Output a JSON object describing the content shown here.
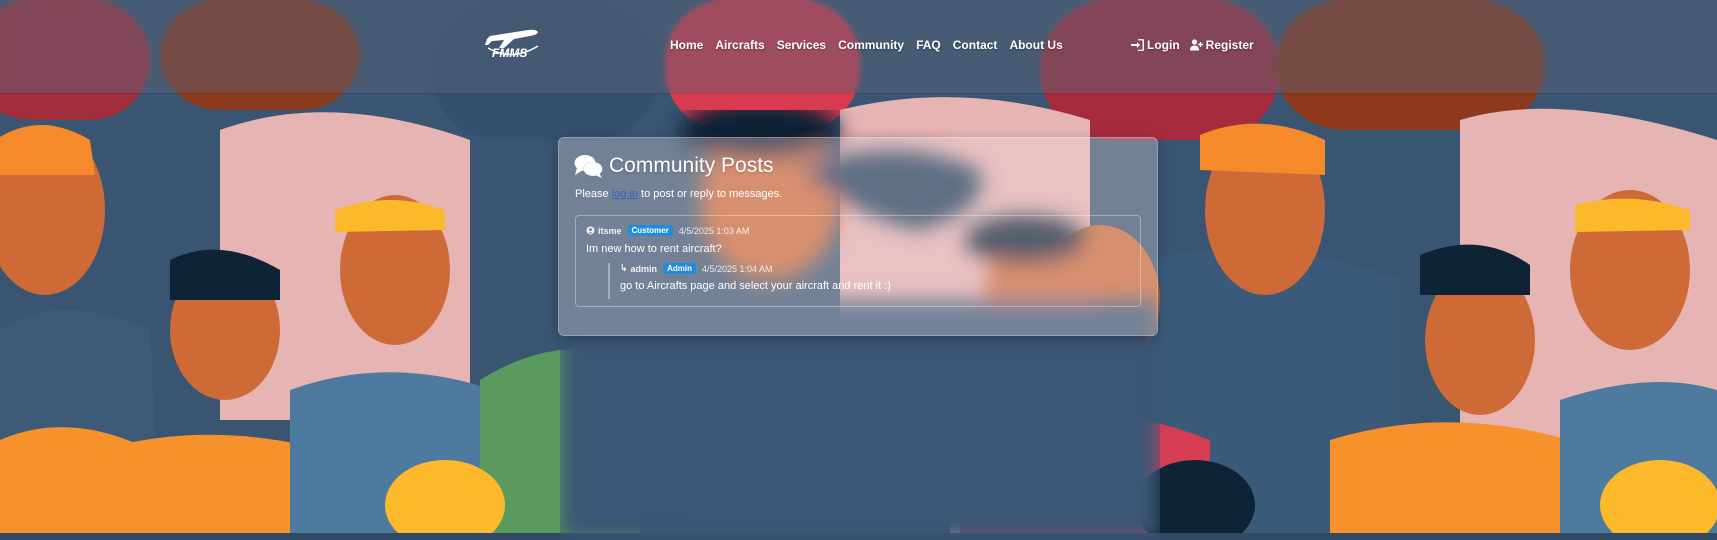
{
  "navbar": {
    "logo_text": "FMMS",
    "links": [
      "Home",
      "Aircrafts",
      "Services",
      "Community",
      "FAQ",
      "Contact",
      "About Us"
    ],
    "login_label": "Login",
    "register_label": "Register"
  },
  "community": {
    "title": "Community Posts",
    "notice_before": "Please ",
    "notice_link": "log in",
    "notice_after": " to post or reply to messages.",
    "posts": [
      {
        "author": "itsme",
        "role": "Customer",
        "timestamp": "4/5/2025 1:03 AM",
        "text": "Im new how to rent aircraft?",
        "replies": [
          {
            "author": "admin",
            "role": "Admin",
            "timestamp": "4/5/2025 1:04 AM",
            "text": "go to Aircrafts page and select your aircraft and rent it :)"
          }
        ]
      }
    ]
  },
  "colors": {
    "nav_overlay": "#5a6478",
    "badge": "#1f8ddc",
    "link": "#2f67b8"
  },
  "icons": {
    "logo": "airplane-logo",
    "login": "sign-in-icon",
    "register": "user-plus-icon",
    "title": "comments-icon",
    "user": "user-circle-icon",
    "reply": "reply-arrow-icon"
  }
}
